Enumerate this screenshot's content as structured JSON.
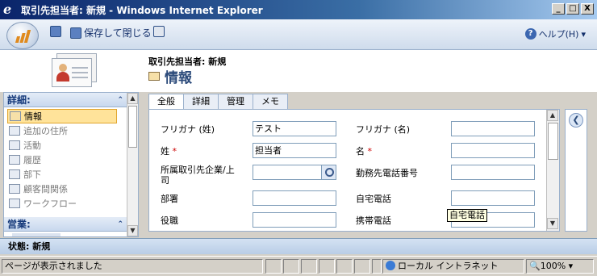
{
  "window": {
    "title": "取引先担当者: 新規 - Windows Internet Explorer",
    "buttons": [
      "_",
      "□",
      "X"
    ]
  },
  "toolbar": {
    "save_label": "",
    "save_close_label": "保存して閉じる",
    "help_label": "ヘルプ(H)",
    "help_arrow": "▾"
  },
  "header": {
    "entity": "取引先担当者: 新規",
    "section": "情報"
  },
  "nav": {
    "section1": "詳細:",
    "section2": "営業:",
    "collapse_glyph": "⌃",
    "items": [
      {
        "label": "情報",
        "selected": true
      },
      {
        "label": "追加の住所",
        "selected": false
      },
      {
        "label": "活動",
        "selected": false
      },
      {
        "label": "履歴",
        "selected": false
      },
      {
        "label": "部下",
        "selected": false
      },
      {
        "label": "顧客間関係",
        "selected": false
      },
      {
        "label": "ワークフロー",
        "selected": false
      }
    ]
  },
  "tabs": [
    "全般",
    "詳細",
    "管理",
    "メモ"
  ],
  "form": {
    "furigana_last_label": "フリガナ (姓)",
    "furigana_last_value": "テスト",
    "furigana_first_label": "フリガナ (名)",
    "furigana_first_value": "",
    "last_name_label": "姓",
    "last_name_value": "担当者",
    "first_name_label": "名",
    "first_name_value": "",
    "parent_label_1": "所属取引先企業/上",
    "parent_label_2": "司",
    "parent_value": "",
    "work_phone_label": "勤務先電話番号",
    "work_phone_value": "",
    "department_label": "部署",
    "department_value": "",
    "home_phone_label": "自宅電話",
    "home_phone_value": "",
    "job_title_label": "役職",
    "job_title_value": "",
    "mobile_label": "携帯電話",
    "mobile_value": "",
    "tooltip": "自宅電話",
    "required_mark": "*"
  },
  "app_status": "状態: 新規",
  "ie_status": {
    "message": "ページが表示されました",
    "zone": "ローカル イントラネット",
    "zoom": "100%",
    "zoom_arrow": "▾"
  }
}
